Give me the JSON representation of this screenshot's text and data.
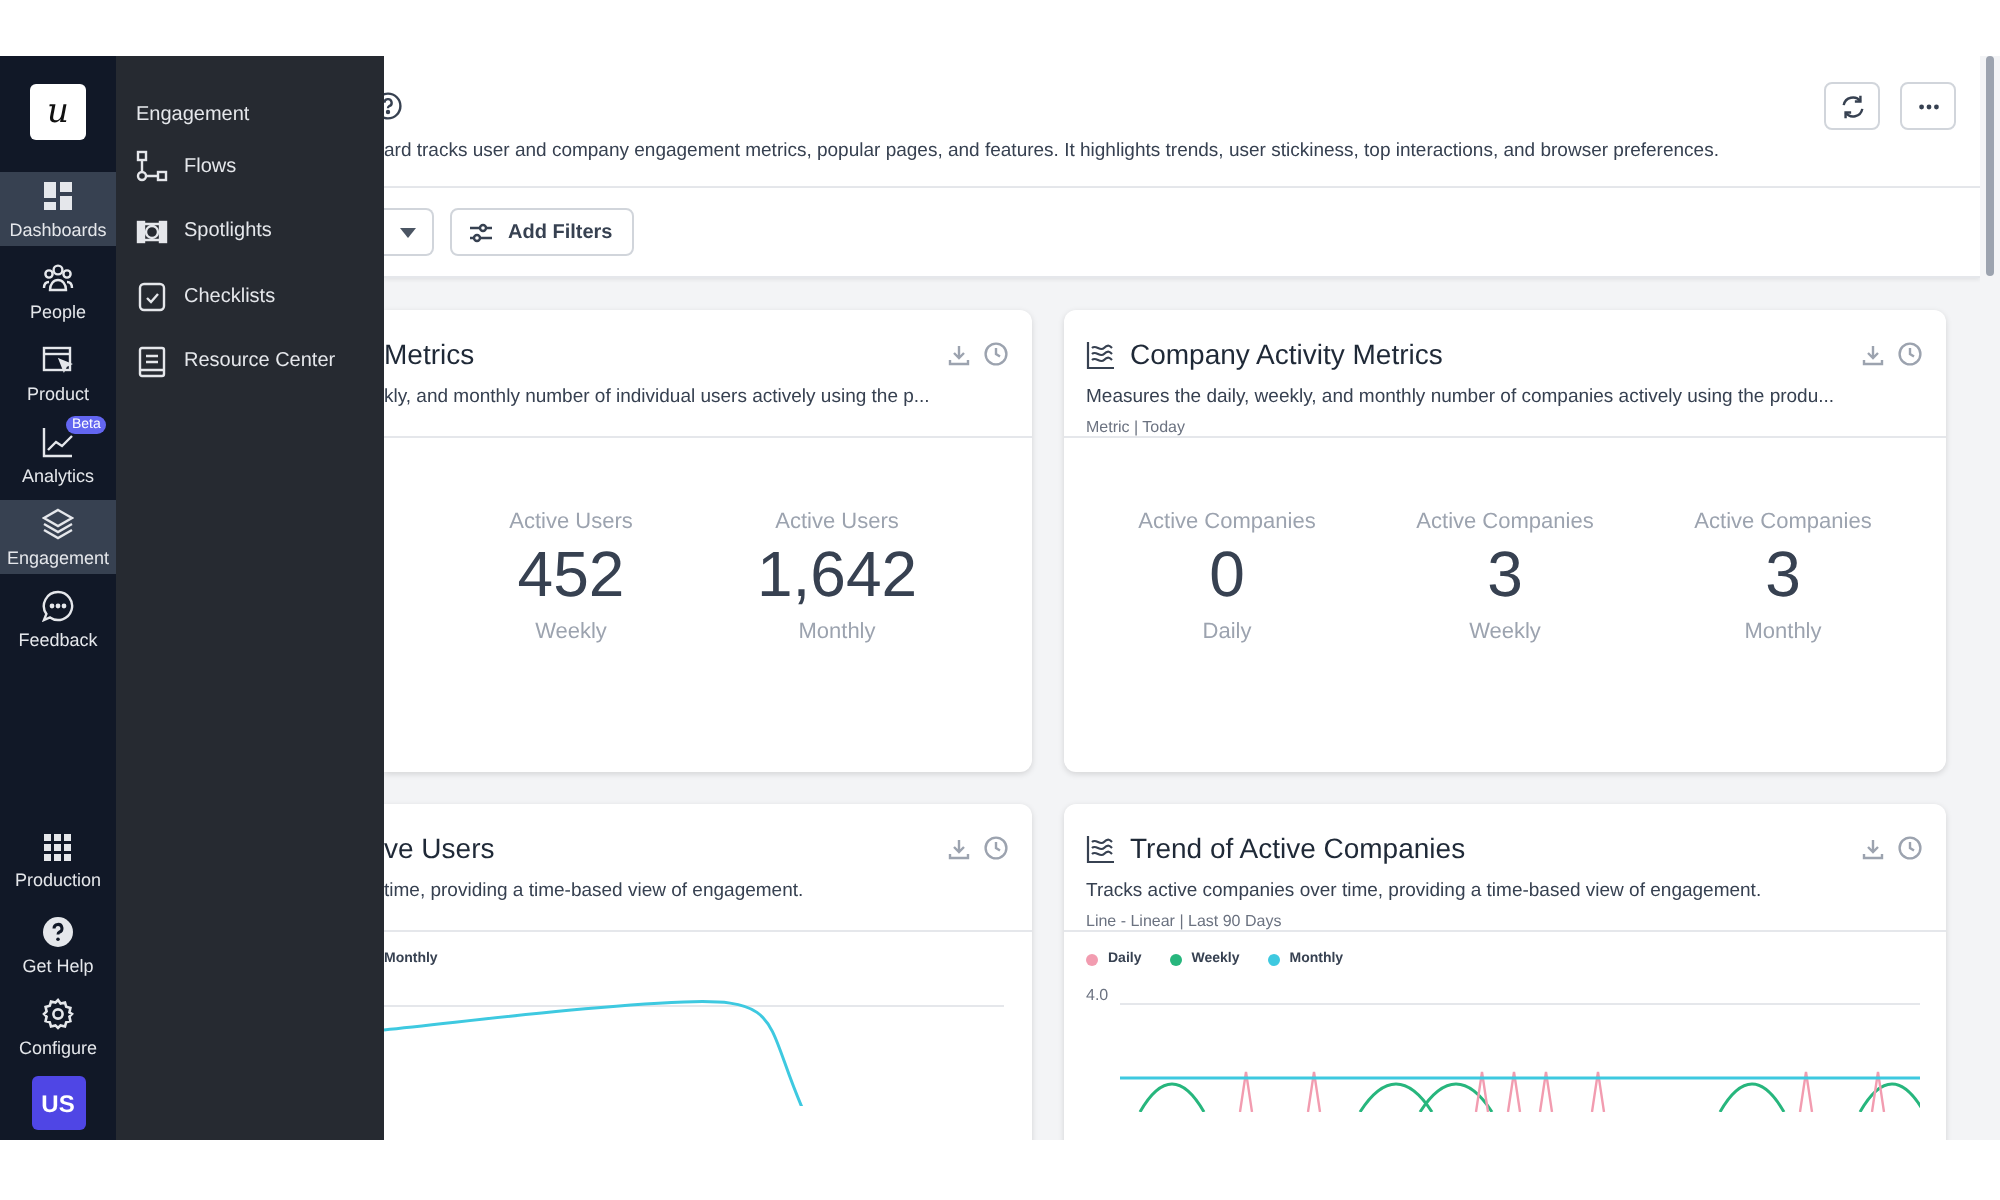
{
  "rail": {
    "items": [
      {
        "label": "Dashboards",
        "kind": "dashboards",
        "highlighted": true
      },
      {
        "label": "People",
        "kind": "people",
        "highlighted": false
      },
      {
        "label": "Product",
        "kind": "product",
        "highlighted": false
      },
      {
        "label": "Analytics",
        "kind": "analytics",
        "highlighted": false,
        "badge": "Beta"
      },
      {
        "label": "Engagement",
        "kind": "engagement",
        "highlighted": true
      },
      {
        "label": "Feedback",
        "kind": "feedback",
        "highlighted": false
      }
    ],
    "bottom_items": [
      {
        "label": "Production",
        "kind": "grid"
      },
      {
        "label": "Get Help",
        "kind": "help"
      },
      {
        "label": "Configure",
        "kind": "gear"
      }
    ],
    "logo": "u",
    "avatar": "US"
  },
  "flyout": {
    "title": "Engagement",
    "items": [
      {
        "label": "Flows",
        "kind": "flows"
      },
      {
        "label": "Spotlights",
        "kind": "spotlights"
      },
      {
        "label": "Checklists",
        "kind": "checklists"
      },
      {
        "label": "Resource Center",
        "kind": "resource"
      }
    ]
  },
  "header": {
    "description": "ard tracks user and company engagement metrics, popular pages, and features. It highlights trends, user stickiness, top interactions, and browser preferences.",
    "filter_button": "Add Filters"
  },
  "cards": [
    {
      "kind": "metric",
      "title": "Metrics",
      "icon": false,
      "description": "kly, and monthly number of individual users actively using the p...",
      "stats": [
        {
          "label": "Active Users",
          "value": "452",
          "period": "Weekly"
        },
        {
          "label": "Active Users",
          "value": "1,642",
          "period": "Monthly"
        }
      ]
    },
    {
      "kind": "metric",
      "title": "Company Activity Metrics",
      "icon": true,
      "description": "Measures the daily, weekly, and monthly number of companies actively using the produ...",
      "meta": "Metric | Today",
      "stats": [
        {
          "label": "Active Companies",
          "value": "0",
          "period": "Daily"
        },
        {
          "label": "Active Companies",
          "value": "3",
          "period": "Weekly"
        },
        {
          "label": "Active Companies",
          "value": "3",
          "period": "Monthly"
        }
      ]
    },
    {
      "kind": "trend",
      "title": "ve Users",
      "icon": false,
      "description": "time, providing a time-based view of engagement.",
      "legend": [
        {
          "label": "Monthly",
          "color": "#3ec9e0",
          "dot": false
        }
      ]
    },
    {
      "kind": "trend",
      "title": "Trend of Active Companies",
      "icon": true,
      "description": "Tracks active companies over time, providing a time-based view of engagement.",
      "meta": "Line - Linear | Last 90 Days",
      "legend": [
        {
          "label": "Daily",
          "color": "#f29cb0",
          "dot": true
        },
        {
          "label": "Weekly",
          "color": "#27b67d",
          "dot": true
        },
        {
          "label": "Monthly",
          "color": "#3ec9e0",
          "dot": true
        }
      ],
      "tick": "4.0"
    }
  ]
}
